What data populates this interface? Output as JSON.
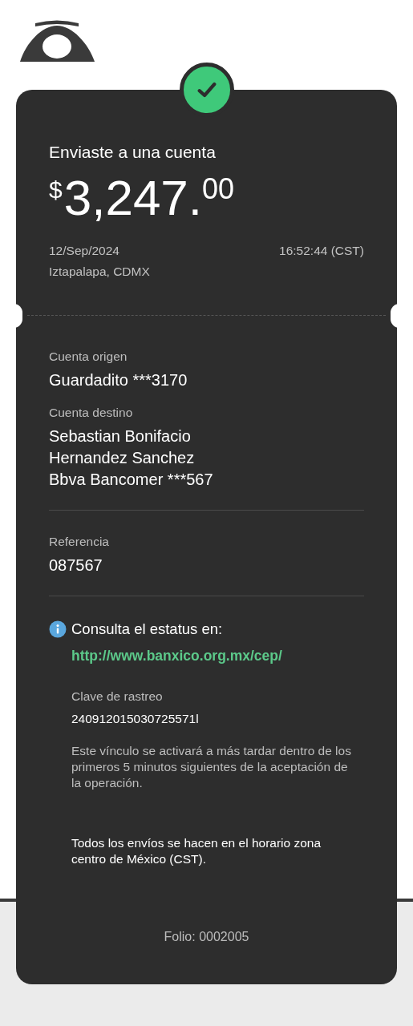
{
  "receipt": {
    "completed": true,
    "title": "Enviaste a una cuenta",
    "amount": {
      "currency": "$",
      "integer": "3,247.",
      "decimals": "00"
    },
    "date": "12/Sep/2024",
    "time": "16:52:44 (CST)",
    "location": "Iztapalapa, CDMX"
  },
  "fields": [
    {
      "label": "Cuenta origen",
      "lines": [
        "Guardadito ***3170"
      ]
    },
    {
      "label": "Cuenta destino",
      "lines": [
        "Sebastian Bonifacio",
        "Hernandez Sanchez",
        "Bbva Bancomer ***567"
      ]
    }
  ],
  "reference": {
    "label": "Referencia",
    "value": "087567"
  },
  "status_info": {
    "heading": "Consulta el estatus en:",
    "link": "http://www.banxico.org.mx/cep/",
    "tracking_label": "Clave de rastreo",
    "tracking_value": "240912015030725571l",
    "note": "Este vínculo se activará a más tardar dentro de los primeros 5 minutos siguientes de la aceptación de la operación.",
    "schedule_note": "Todos los envíos se hacen en el horario zona centro de México (CST)."
  },
  "folio": "Folio: 0002005"
}
